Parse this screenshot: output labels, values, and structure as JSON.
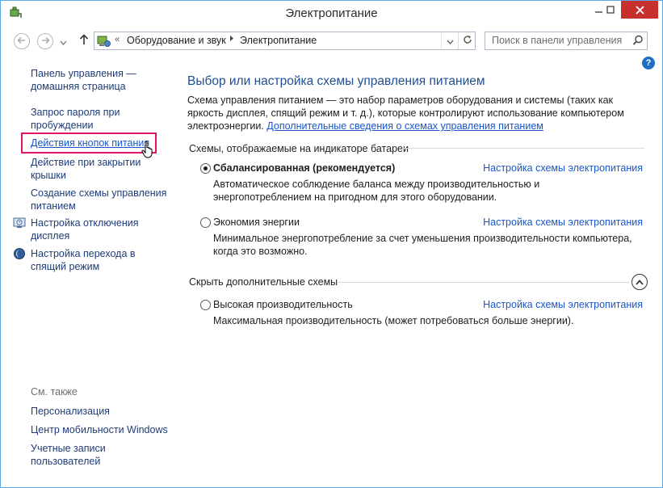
{
  "window": {
    "title": "Электропитание"
  },
  "address": {
    "crumbs": [
      "Оборудование и звук",
      "Электропитание"
    ],
    "overflow": "«"
  },
  "search": {
    "placeholder": "Поиск в панели управления"
  },
  "sidebar": {
    "links": [
      {
        "id": "home",
        "label": "Панель управления —\nдомашняя страница"
      },
      {
        "id": "password",
        "label": "Запрос пароля при\nпробуждении"
      },
      {
        "id": "power-buttons",
        "label": "Действия кнопок питания"
      },
      {
        "id": "lid",
        "label": "Действие при закрытии\nкрышки"
      },
      {
        "id": "create-plan",
        "label": "Создание схемы управления\nпитанием"
      },
      {
        "id": "display-off",
        "label": "Настройка отключения\nдисплея"
      },
      {
        "id": "sleep",
        "label": "Настройка перехода в\nспящий режим"
      }
    ],
    "see_also_title": "См. также",
    "see_also": [
      {
        "id": "personalization",
        "label": "Персонализация"
      },
      {
        "id": "mobility",
        "label": "Центр мобильности Windows"
      },
      {
        "id": "accounts",
        "label": "Учетные записи\nпользователей"
      }
    ]
  },
  "main": {
    "title": "Выбор или настройка схемы управления питанием",
    "intro": "Схема управления питанием — это набор параметров оборудования и системы (таких как яркость дисплея, спящий режим и т. д.), которые контролируют использование компьютером электроэнергии.",
    "intro_link": "Дополнительные сведения о схемах управления питанием",
    "battery_group": "Схемы, отображаемые на индикаторе батареи",
    "hidden_group": "Скрыть дополнительные схемы",
    "plan_link": "Настройка схемы электропитания",
    "plans": [
      {
        "id": "balanced",
        "name": "Сбалансированная (рекомендуется)",
        "selected": true,
        "desc": "Автоматическое соблюдение баланса между производительностью и энергопотреблением на пригодном для этого оборудовании."
      },
      {
        "id": "saver",
        "name": "Экономия энергии",
        "selected": false,
        "desc": "Минимальное энергопотребление за счет уменьшения производительности компьютера, когда это возможно."
      },
      {
        "id": "high",
        "name": "Высокая производительность",
        "selected": false,
        "desc": "Максимальная производительность (может потребоваться больше энергии)."
      }
    ]
  },
  "colors": {
    "accent": "#1f4e91",
    "link": "#1a56c9",
    "close": "#c7312d",
    "highlight": "#e0166b"
  },
  "icons": [
    "control-panel-icon",
    "back-arrow-icon",
    "forward-arrow-icon",
    "up-arrow-icon",
    "refresh-icon",
    "search-icon",
    "help-icon",
    "display-settings-icon",
    "sleep-moon-icon",
    "hand-cursor-icon"
  ]
}
